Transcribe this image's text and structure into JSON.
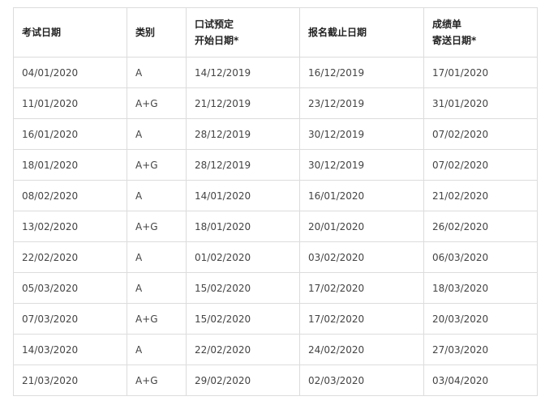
{
  "table": {
    "headers": {
      "exam_date": "考试日期",
      "category": "类别",
      "speaking_line1": "口试预定",
      "speaking_line2": "开始日期*",
      "deadline": "报名截止日期",
      "results_line1": "成绩单",
      "results_line2": "寄送日期*"
    },
    "rows": [
      [
        "04/01/2020",
        "A",
        "14/12/2019",
        "16/12/2019",
        "17/01/2020"
      ],
      [
        "11/01/2020",
        "A+G",
        "21/12/2019",
        "23/12/2019",
        "31/01/2020"
      ],
      [
        "16/01/2020",
        "A",
        "28/12/2019",
        "30/12/2019",
        "07/02/2020"
      ],
      [
        "18/01/2020",
        "A+G",
        "28/12/2019",
        "30/12/2019",
        "07/02/2020"
      ],
      [
        "08/02/2020",
        "A",
        "14/01/2020",
        "16/01/2020",
        "21/02/2020"
      ],
      [
        "13/02/2020",
        "A+G",
        "18/01/2020",
        "20/01/2020",
        "26/02/2020"
      ],
      [
        "22/02/2020",
        "A",
        "01/02/2020",
        "03/02/2020",
        "06/03/2020"
      ],
      [
        "05/03/2020",
        "A",
        "15/02/2020",
        "17/02/2020",
        "18/03/2020"
      ],
      [
        "07/03/2020",
        "A+G",
        "15/02/2020",
        "17/02/2020",
        "20/03/2020"
      ],
      [
        "14/03/2020",
        "A",
        "22/02/2020",
        "24/02/2020",
        "27/03/2020"
      ],
      [
        "21/03/2020",
        "A+G",
        "29/02/2020",
        "02/03/2020",
        "03/04/2020"
      ]
    ]
  }
}
